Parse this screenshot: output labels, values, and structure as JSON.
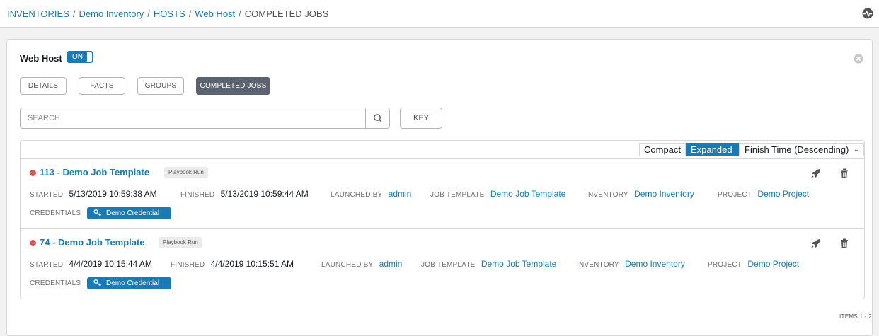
{
  "breadcrumb": {
    "items": [
      "INVENTORIES",
      "Demo Inventory",
      "HOSTS",
      "Web Host"
    ],
    "current": "COMPLETED JOBS",
    "separator": "/"
  },
  "host": {
    "name": "Web Host",
    "toggle_label": "ON"
  },
  "tabs": [
    {
      "label": "DETAILS"
    },
    {
      "label": "FACTS"
    },
    {
      "label": "GROUPS"
    },
    {
      "label": "COMPLETED JOBS",
      "active": true
    }
  ],
  "search": {
    "placeholder": "SEARCH",
    "key_label": "KEY"
  },
  "list_controls": {
    "compact_label": "Compact",
    "expanded_label": "Expanded",
    "sort_label": "Finish Time (Descending)",
    "active_view": "Expanded"
  },
  "labels": {
    "started": "STARTED",
    "finished": "FINISHED",
    "launched_by": "LAUNCHED BY",
    "job_template": "JOB TEMPLATE",
    "inventory": "INVENTORY",
    "project": "PROJECT",
    "credentials": "CREDENTIALS"
  },
  "jobs": [
    {
      "title": "113 - Demo Job Template",
      "type": "Playbook Run",
      "status": "failed",
      "started": "5/13/2019 10:59:38 AM",
      "finished": "5/13/2019 10:59:44 AM",
      "launched_by": "admin",
      "job_template": "Demo Job Template",
      "inventory": "Demo Inventory",
      "project": "Demo Project",
      "credential": "Demo Credential"
    },
    {
      "title": "74 - Demo Job Template",
      "type": "Playbook Run",
      "status": "failed",
      "started": "4/4/2019 10:15:44 AM",
      "finished": "4/4/2019 10:15:51 AM",
      "launched_by": "admin",
      "job_template": "Demo Job Template",
      "inventory": "Demo Inventory",
      "project": "Demo Project",
      "credential": "Demo Credential"
    }
  ],
  "pagination": {
    "items_text": "ITEMS  1 - 2"
  },
  "colors": {
    "link": "#1a7ab5",
    "active_tab": "#5b6270",
    "error": "#d9534f"
  }
}
